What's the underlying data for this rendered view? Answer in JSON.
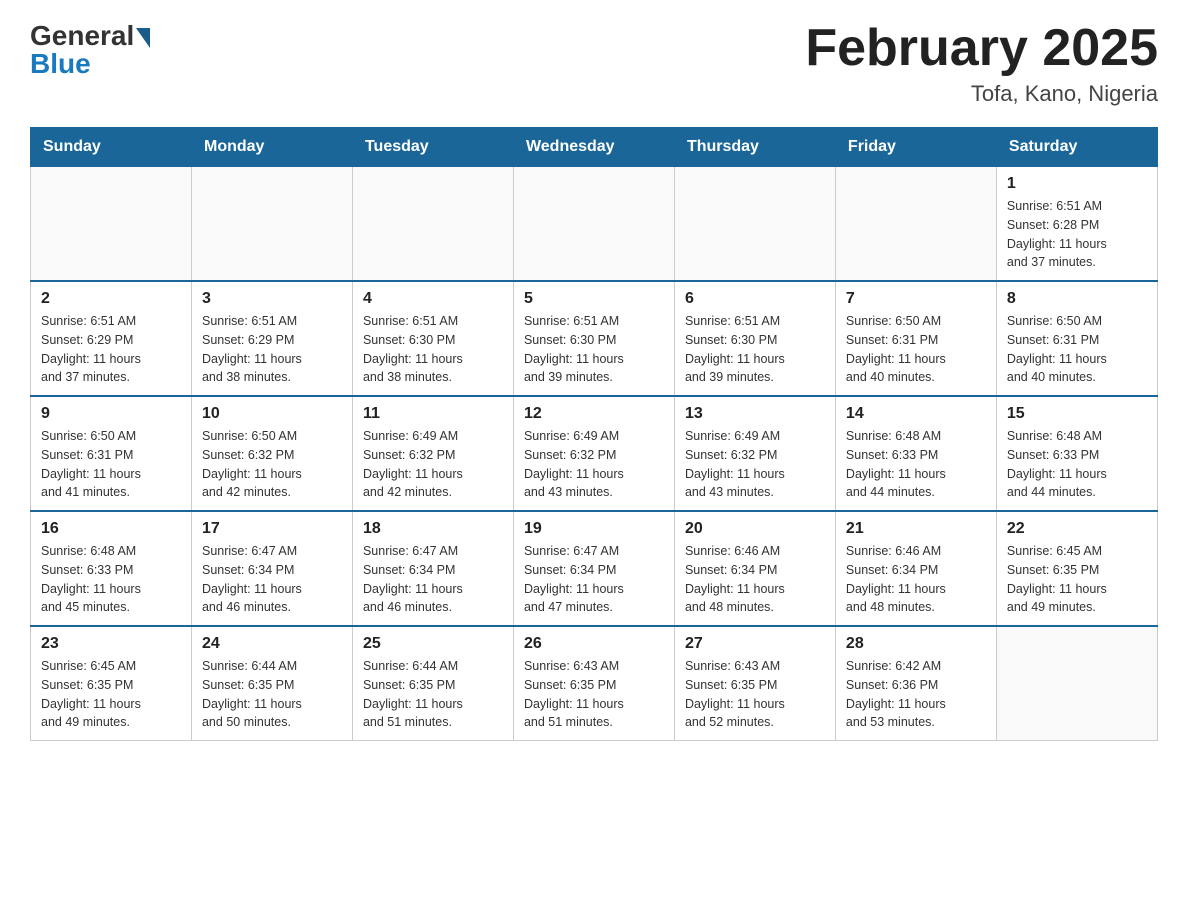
{
  "header": {
    "logo_general": "General",
    "logo_blue": "Blue",
    "month_title": "February 2025",
    "location": "Tofa, Kano, Nigeria"
  },
  "days_of_week": [
    "Sunday",
    "Monday",
    "Tuesday",
    "Wednesday",
    "Thursday",
    "Friday",
    "Saturday"
  ],
  "weeks": [
    [
      {
        "day": "",
        "info": ""
      },
      {
        "day": "",
        "info": ""
      },
      {
        "day": "",
        "info": ""
      },
      {
        "day": "",
        "info": ""
      },
      {
        "day": "",
        "info": ""
      },
      {
        "day": "",
        "info": ""
      },
      {
        "day": "1",
        "info": "Sunrise: 6:51 AM\nSunset: 6:28 PM\nDaylight: 11 hours\nand 37 minutes."
      }
    ],
    [
      {
        "day": "2",
        "info": "Sunrise: 6:51 AM\nSunset: 6:29 PM\nDaylight: 11 hours\nand 37 minutes."
      },
      {
        "day": "3",
        "info": "Sunrise: 6:51 AM\nSunset: 6:29 PM\nDaylight: 11 hours\nand 38 minutes."
      },
      {
        "day": "4",
        "info": "Sunrise: 6:51 AM\nSunset: 6:30 PM\nDaylight: 11 hours\nand 38 minutes."
      },
      {
        "day": "5",
        "info": "Sunrise: 6:51 AM\nSunset: 6:30 PM\nDaylight: 11 hours\nand 39 minutes."
      },
      {
        "day": "6",
        "info": "Sunrise: 6:51 AM\nSunset: 6:30 PM\nDaylight: 11 hours\nand 39 minutes."
      },
      {
        "day": "7",
        "info": "Sunrise: 6:50 AM\nSunset: 6:31 PM\nDaylight: 11 hours\nand 40 minutes."
      },
      {
        "day": "8",
        "info": "Sunrise: 6:50 AM\nSunset: 6:31 PM\nDaylight: 11 hours\nand 40 minutes."
      }
    ],
    [
      {
        "day": "9",
        "info": "Sunrise: 6:50 AM\nSunset: 6:31 PM\nDaylight: 11 hours\nand 41 minutes."
      },
      {
        "day": "10",
        "info": "Sunrise: 6:50 AM\nSunset: 6:32 PM\nDaylight: 11 hours\nand 42 minutes."
      },
      {
        "day": "11",
        "info": "Sunrise: 6:49 AM\nSunset: 6:32 PM\nDaylight: 11 hours\nand 42 minutes."
      },
      {
        "day": "12",
        "info": "Sunrise: 6:49 AM\nSunset: 6:32 PM\nDaylight: 11 hours\nand 43 minutes."
      },
      {
        "day": "13",
        "info": "Sunrise: 6:49 AM\nSunset: 6:32 PM\nDaylight: 11 hours\nand 43 minutes."
      },
      {
        "day": "14",
        "info": "Sunrise: 6:48 AM\nSunset: 6:33 PM\nDaylight: 11 hours\nand 44 minutes."
      },
      {
        "day": "15",
        "info": "Sunrise: 6:48 AM\nSunset: 6:33 PM\nDaylight: 11 hours\nand 44 minutes."
      }
    ],
    [
      {
        "day": "16",
        "info": "Sunrise: 6:48 AM\nSunset: 6:33 PM\nDaylight: 11 hours\nand 45 minutes."
      },
      {
        "day": "17",
        "info": "Sunrise: 6:47 AM\nSunset: 6:34 PM\nDaylight: 11 hours\nand 46 minutes."
      },
      {
        "day": "18",
        "info": "Sunrise: 6:47 AM\nSunset: 6:34 PM\nDaylight: 11 hours\nand 46 minutes."
      },
      {
        "day": "19",
        "info": "Sunrise: 6:47 AM\nSunset: 6:34 PM\nDaylight: 11 hours\nand 47 minutes."
      },
      {
        "day": "20",
        "info": "Sunrise: 6:46 AM\nSunset: 6:34 PM\nDaylight: 11 hours\nand 48 minutes."
      },
      {
        "day": "21",
        "info": "Sunrise: 6:46 AM\nSunset: 6:34 PM\nDaylight: 11 hours\nand 48 minutes."
      },
      {
        "day": "22",
        "info": "Sunrise: 6:45 AM\nSunset: 6:35 PM\nDaylight: 11 hours\nand 49 minutes."
      }
    ],
    [
      {
        "day": "23",
        "info": "Sunrise: 6:45 AM\nSunset: 6:35 PM\nDaylight: 11 hours\nand 49 minutes."
      },
      {
        "day": "24",
        "info": "Sunrise: 6:44 AM\nSunset: 6:35 PM\nDaylight: 11 hours\nand 50 minutes."
      },
      {
        "day": "25",
        "info": "Sunrise: 6:44 AM\nSunset: 6:35 PM\nDaylight: 11 hours\nand 51 minutes."
      },
      {
        "day": "26",
        "info": "Sunrise: 6:43 AM\nSunset: 6:35 PM\nDaylight: 11 hours\nand 51 minutes."
      },
      {
        "day": "27",
        "info": "Sunrise: 6:43 AM\nSunset: 6:35 PM\nDaylight: 11 hours\nand 52 minutes."
      },
      {
        "day": "28",
        "info": "Sunrise: 6:42 AM\nSunset: 6:36 PM\nDaylight: 11 hours\nand 53 minutes."
      },
      {
        "day": "",
        "info": ""
      }
    ]
  ]
}
